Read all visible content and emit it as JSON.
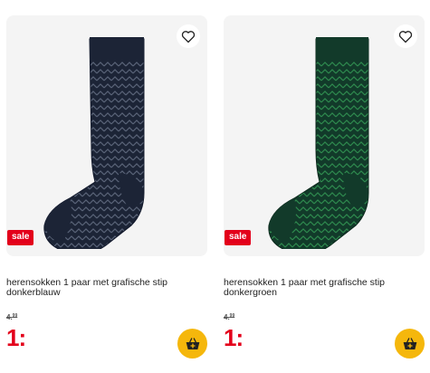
{
  "products": [
    {
      "title_line1": "herensokken 1 paar met grafische stip",
      "title_line2": "donkerblauw",
      "badge": "sale",
      "old_price_main": "4.",
      "old_price_cents": "99",
      "new_price": "1:",
      "sock_color": "#1c2436",
      "sock_pattern_color": "#5a6478",
      "icons": [
        "heart-outline-icon",
        "basket-icon"
      ]
    },
    {
      "title_line1": "herensokken 1 paar met grafische stip",
      "title_line2": "donkergroen",
      "badge": "sale",
      "old_price_main": "4.",
      "old_price_cents": "99",
      "new_price": "1:",
      "sock_color": "#123a2a",
      "sock_pattern_color": "#2e8a4e",
      "icons": [
        "heart-outline-icon",
        "basket-icon"
      ]
    }
  ],
  "colors": {
    "sale_red": "#e3001b",
    "cart_yellow": "#f5b70c",
    "image_bg": "#f4f4f4"
  }
}
